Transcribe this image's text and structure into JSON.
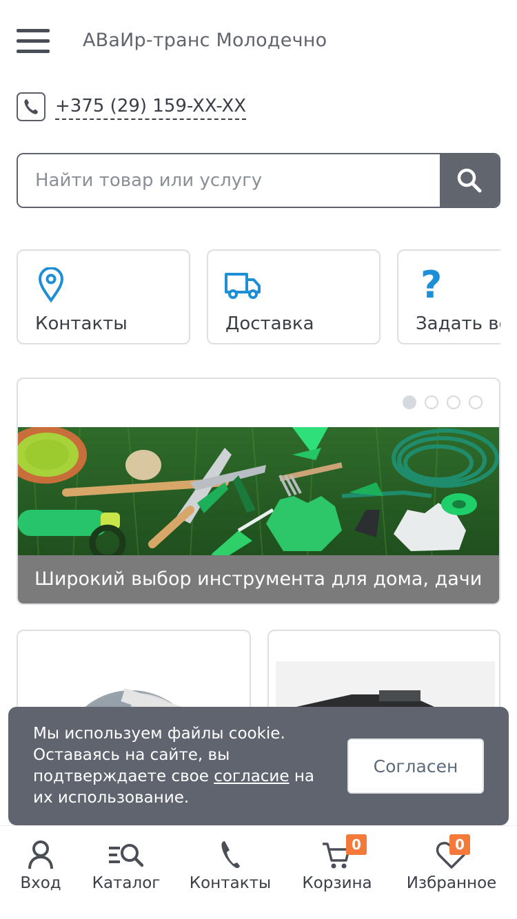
{
  "header": {
    "menu_icon": "hamburger-menu-icon",
    "title": "АВаИр-транс Молодечно"
  },
  "contact": {
    "phone_icon": "phone-icon",
    "phone": "+375 (29) 159-XX-XX"
  },
  "search": {
    "placeholder": "Найти товар или услугу",
    "button_icon": "search-icon"
  },
  "quick_links": [
    {
      "label": "Контакты",
      "icon": "location-pin-icon"
    },
    {
      "label": "Доставка",
      "icon": "delivery-truck-icon"
    },
    {
      "label": "Задать вопрос",
      "icon": "question-mark-icon"
    }
  ],
  "banner": {
    "slide_count": 4,
    "active_slide": 1,
    "caption": "Широкий выбор инструмента для дома, дачи"
  },
  "cookie": {
    "text_before": "Мы используем файлы cookie. Оставаясь на сайте, вы подтверждаете свое ",
    "link": "согласие",
    "text_after": " на их использование.",
    "button": "Согласен"
  },
  "bottom_nav": {
    "login": "Вход",
    "catalog": "Каталог",
    "contacts": "Контакты",
    "cart": "Корзина",
    "cart_count": "0",
    "favorites": "Избранное",
    "favorites_count": "0"
  },
  "colors": {
    "accent": "#1e8fd6",
    "dark": "#60656e",
    "badge": "#f47a3c"
  }
}
